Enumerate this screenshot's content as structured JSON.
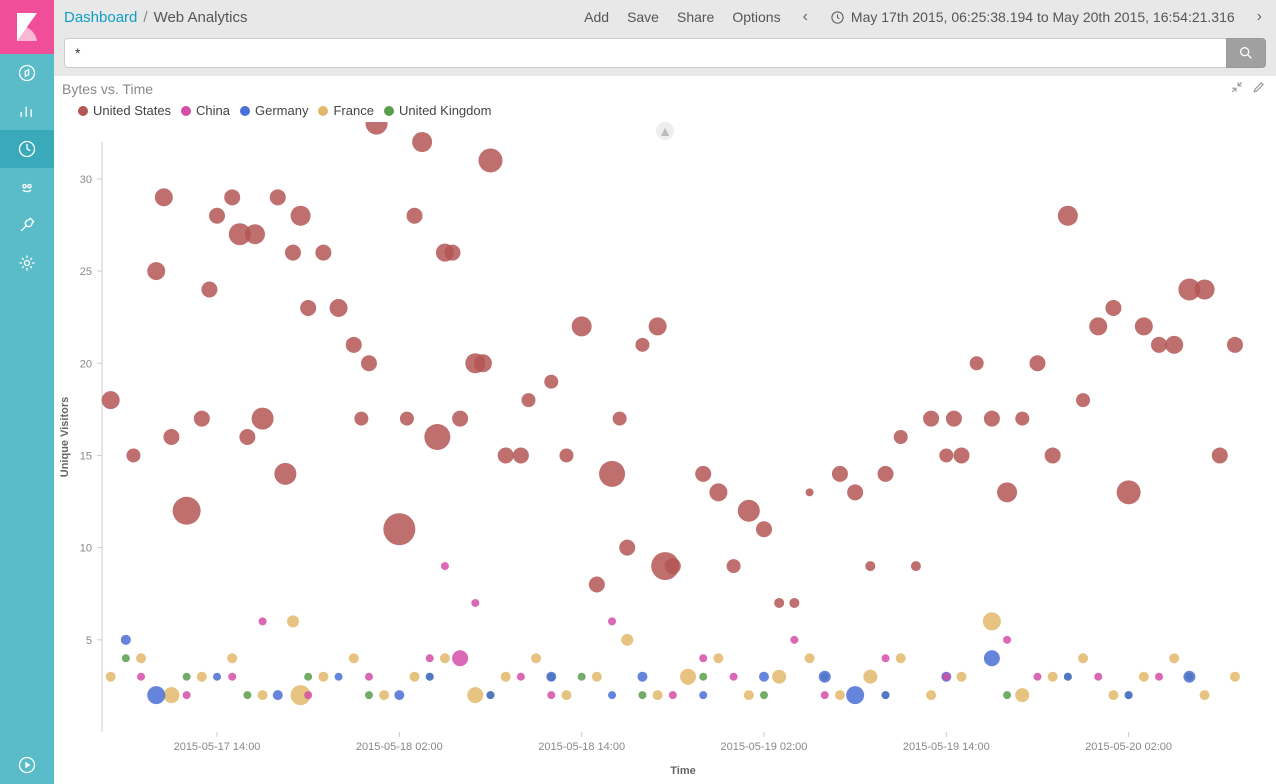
{
  "breadcrumb": {
    "root": "Dashboard",
    "current": "Web Analytics"
  },
  "actions": {
    "add": "Add",
    "save": "Save",
    "share": "Share",
    "options": "Options"
  },
  "time_range": "May 17th 2015, 06:25:38.194 to May 20th 2015, 16:54:21.316",
  "search": {
    "value": "*",
    "placeholder": ""
  },
  "panel": {
    "title": "Bytes vs. Time"
  },
  "legend": {
    "items": [
      {
        "key": "us",
        "label": "United States",
        "color": "#b35655"
      },
      {
        "key": "cn",
        "label": "China",
        "color": "#d54da8"
      },
      {
        "key": "de",
        "label": "Germany",
        "color": "#4a6fd6"
      },
      {
        "key": "fr",
        "label": "France",
        "color": "#e3b86b"
      },
      {
        "key": "gb",
        "label": "United Kingdom",
        "color": "#5a9e4d"
      }
    ]
  },
  "chart_data": {
    "type": "scatter",
    "title": "Bytes vs. Time",
    "xlabel": "Time",
    "ylabel": "Unique Visitors",
    "ylim": [
      0,
      32
    ],
    "x_ticks": [
      "2015-05-17 14:00",
      "2015-05-18 02:00",
      "2015-05-18 14:00",
      "2015-05-19 02:00",
      "2015-05-19 14:00",
      "2015-05-20 02:00"
    ],
    "x_tick_hours": [
      14,
      26,
      38,
      50,
      62,
      74
    ],
    "x_range_hours": [
      6.43,
      82.91
    ],
    "series": [
      {
        "name": "United States",
        "color": "#b35655",
        "points": [
          {
            "x": 7,
            "y": 18,
            "r": 9
          },
          {
            "x": 8.5,
            "y": 15,
            "r": 7
          },
          {
            "x": 10,
            "y": 25,
            "r": 9
          },
          {
            "x": 10.5,
            "y": 29,
            "r": 9
          },
          {
            "x": 11,
            "y": 16,
            "r": 8
          },
          {
            "x": 12,
            "y": 12,
            "r": 14
          },
          {
            "x": 13,
            "y": 17,
            "r": 8
          },
          {
            "x": 13.5,
            "y": 24,
            "r": 8
          },
          {
            "x": 14,
            "y": 28,
            "r": 8
          },
          {
            "x": 15,
            "y": 29,
            "r": 8
          },
          {
            "x": 15.5,
            "y": 27,
            "r": 11
          },
          {
            "x": 16,
            "y": 16,
            "r": 8
          },
          {
            "x": 16.5,
            "y": 27,
            "r": 10
          },
          {
            "x": 17,
            "y": 17,
            "r": 11
          },
          {
            "x": 18,
            "y": 29,
            "r": 8
          },
          {
            "x": 18.5,
            "y": 14,
            "r": 11
          },
          {
            "x": 19,
            "y": 26,
            "r": 8
          },
          {
            "x": 19.5,
            "y": 28,
            "r": 10
          },
          {
            "x": 20,
            "y": 23,
            "r": 8
          },
          {
            "x": 21,
            "y": 26,
            "r": 8
          },
          {
            "x": 22,
            "y": 23,
            "r": 9
          },
          {
            "x": 23,
            "y": 21,
            "r": 8
          },
          {
            "x": 23.5,
            "y": 17,
            "r": 7
          },
          {
            "x": 24,
            "y": 20,
            "r": 8
          },
          {
            "x": 24.5,
            "y": 33,
            "r": 11
          },
          {
            "x": 26,
            "y": 11,
            "r": 16
          },
          {
            "x": 26.5,
            "y": 17,
            "r": 7
          },
          {
            "x": 27,
            "y": 28,
            "r": 8
          },
          {
            "x": 27.5,
            "y": 32,
            "r": 10
          },
          {
            "x": 28.5,
            "y": 16,
            "r": 13
          },
          {
            "x": 29,
            "y": 26,
            "r": 9
          },
          {
            "x": 29.5,
            "y": 26,
            "r": 8
          },
          {
            "x": 30,
            "y": 17,
            "r": 8
          },
          {
            "x": 31,
            "y": 20,
            "r": 10
          },
          {
            "x": 31.5,
            "y": 20,
            "r": 9
          },
          {
            "x": 32,
            "y": 31,
            "r": 12
          },
          {
            "x": 33,
            "y": 15,
            "r": 8
          },
          {
            "x": 34,
            "y": 15,
            "r": 8
          },
          {
            "x": 34.5,
            "y": 18,
            "r": 7
          },
          {
            "x": 36,
            "y": 19,
            "r": 7
          },
          {
            "x": 37,
            "y": 15,
            "r": 7
          },
          {
            "x": 38,
            "y": 22,
            "r": 10
          },
          {
            "x": 39,
            "y": 8,
            "r": 8
          },
          {
            "x": 40,
            "y": 14,
            "r": 13
          },
          {
            "x": 40.5,
            "y": 17,
            "r": 7
          },
          {
            "x": 41,
            "y": 10,
            "r": 8
          },
          {
            "x": 42,
            "y": 21,
            "r": 7
          },
          {
            "x": 43,
            "y": 22,
            "r": 9
          },
          {
            "x": 43.5,
            "y": 9,
            "r": 14
          },
          {
            "x": 44,
            "y": 9,
            "r": 8
          },
          {
            "x": 46,
            "y": 14,
            "r": 8
          },
          {
            "x": 47,
            "y": 13,
            "r": 9
          },
          {
            "x": 48,
            "y": 9,
            "r": 7
          },
          {
            "x": 49,
            "y": 12,
            "r": 11
          },
          {
            "x": 50,
            "y": 11,
            "r": 8
          },
          {
            "x": 51,
            "y": 7,
            "r": 5
          },
          {
            "x": 52,
            "y": 7,
            "r": 5
          },
          {
            "x": 53,
            "y": 13,
            "r": 4
          },
          {
            "x": 55,
            "y": 14,
            "r": 8
          },
          {
            "x": 56,
            "y": 13,
            "r": 8
          },
          {
            "x": 57,
            "y": 9,
            "r": 5
          },
          {
            "x": 58,
            "y": 14,
            "r": 8
          },
          {
            "x": 59,
            "y": 16,
            "r": 7
          },
          {
            "x": 60,
            "y": 9,
            "r": 5
          },
          {
            "x": 61,
            "y": 17,
            "r": 8
          },
          {
            "x": 62,
            "y": 15,
            "r": 7
          },
          {
            "x": 62.5,
            "y": 17,
            "r": 8
          },
          {
            "x": 63,
            "y": 15,
            "r": 8
          },
          {
            "x": 64,
            "y": 20,
            "r": 7
          },
          {
            "x": 65,
            "y": 17,
            "r": 8
          },
          {
            "x": 66,
            "y": 13,
            "r": 10
          },
          {
            "x": 67,
            "y": 17,
            "r": 7
          },
          {
            "x": 68,
            "y": 20,
            "r": 8
          },
          {
            "x": 69,
            "y": 15,
            "r": 8
          },
          {
            "x": 70,
            "y": 28,
            "r": 10
          },
          {
            "x": 71,
            "y": 18,
            "r": 7
          },
          {
            "x": 72,
            "y": 22,
            "r": 9
          },
          {
            "x": 73,
            "y": 23,
            "r": 8
          },
          {
            "x": 74,
            "y": 13,
            "r": 12
          },
          {
            "x": 75,
            "y": 22,
            "r": 9
          },
          {
            "x": 76,
            "y": 21,
            "r": 8
          },
          {
            "x": 77,
            "y": 21,
            "r": 9
          },
          {
            "x": 78,
            "y": 24,
            "r": 11
          },
          {
            "x": 79,
            "y": 24,
            "r": 10
          },
          {
            "x": 80,
            "y": 15,
            "r": 8
          },
          {
            "x": 81,
            "y": 21,
            "r": 8
          }
        ]
      },
      {
        "name": "China",
        "color": "#d54da8",
        "points": [
          {
            "x": 9,
            "y": 3,
            "r": 4
          },
          {
            "x": 12,
            "y": 2,
            "r": 4
          },
          {
            "x": 15,
            "y": 3,
            "r": 4
          },
          {
            "x": 17,
            "y": 6,
            "r": 4
          },
          {
            "x": 20,
            "y": 2,
            "r": 4
          },
          {
            "x": 24,
            "y": 3,
            "r": 4
          },
          {
            "x": 28,
            "y": 4,
            "r": 4
          },
          {
            "x": 29,
            "y": 9,
            "r": 4
          },
          {
            "x": 30,
            "y": 4,
            "r": 8
          },
          {
            "x": 31,
            "y": 7,
            "r": 4
          },
          {
            "x": 34,
            "y": 3,
            "r": 4
          },
          {
            "x": 36,
            "y": 2,
            "r": 4
          },
          {
            "x": 40,
            "y": 6,
            "r": 4
          },
          {
            "x": 44,
            "y": 2,
            "r": 4
          },
          {
            "x": 46,
            "y": 4,
            "r": 4
          },
          {
            "x": 48,
            "y": 3,
            "r": 4
          },
          {
            "x": 52,
            "y": 5,
            "r": 4
          },
          {
            "x": 54,
            "y": 2,
            "r": 4
          },
          {
            "x": 58,
            "y": 4,
            "r": 4
          },
          {
            "x": 62,
            "y": 3,
            "r": 4
          },
          {
            "x": 66,
            "y": 5,
            "r": 4
          },
          {
            "x": 68,
            "y": 3,
            "r": 4
          },
          {
            "x": 72,
            "y": 3,
            "r": 4
          },
          {
            "x": 76,
            "y": 3,
            "r": 4
          }
        ]
      },
      {
        "name": "Germany",
        "color": "#4a6fd6",
        "points": [
          {
            "x": 8,
            "y": 5,
            "r": 5
          },
          {
            "x": 10,
            "y": 2,
            "r": 9
          },
          {
            "x": 14,
            "y": 3,
            "r": 4
          },
          {
            "x": 18,
            "y": 2,
            "r": 5
          },
          {
            "x": 22,
            "y": 3,
            "r": 4
          },
          {
            "x": 26,
            "y": 2,
            "r": 5
          },
          {
            "x": 28,
            "y": 3,
            "r": 4
          },
          {
            "x": 32,
            "y": 2,
            "r": 4
          },
          {
            "x": 36,
            "y": 3,
            "r": 5
          },
          {
            "x": 40,
            "y": 2,
            "r": 4
          },
          {
            "x": 42,
            "y": 3,
            "r": 5
          },
          {
            "x": 46,
            "y": 2,
            "r": 4
          },
          {
            "x": 50,
            "y": 3,
            "r": 5
          },
          {
            "x": 54,
            "y": 3,
            "r": 6
          },
          {
            "x": 56,
            "y": 2,
            "r": 9
          },
          {
            "x": 58,
            "y": 2,
            "r": 4
          },
          {
            "x": 62,
            "y": 3,
            "r": 5
          },
          {
            "x": 65,
            "y": 4,
            "r": 8
          },
          {
            "x": 70,
            "y": 3,
            "r": 4
          },
          {
            "x": 74,
            "y": 2,
            "r": 4
          },
          {
            "x": 78,
            "y": 3,
            "r": 6
          }
        ]
      },
      {
        "name": "France",
        "color": "#e3b86b",
        "points": [
          {
            "x": 7,
            "y": 3,
            "r": 5
          },
          {
            "x": 9,
            "y": 4,
            "r": 5
          },
          {
            "x": 11,
            "y": 2,
            "r": 8
          },
          {
            "x": 13,
            "y": 3,
            "r": 5
          },
          {
            "x": 15,
            "y": 4,
            "r": 5
          },
          {
            "x": 17,
            "y": 2,
            "r": 5
          },
          {
            "x": 19,
            "y": 6,
            "r": 6
          },
          {
            "x": 19.5,
            "y": 2,
            "r": 10
          },
          {
            "x": 21,
            "y": 3,
            "r": 5
          },
          {
            "x": 23,
            "y": 4,
            "r": 5
          },
          {
            "x": 25,
            "y": 2,
            "r": 5
          },
          {
            "x": 27,
            "y": 3,
            "r": 5
          },
          {
            "x": 29,
            "y": 4,
            "r": 5
          },
          {
            "x": 31,
            "y": 2,
            "r": 8
          },
          {
            "x": 33,
            "y": 3,
            "r": 5
          },
          {
            "x": 35,
            "y": 4,
            "r": 5
          },
          {
            "x": 37,
            "y": 2,
            "r": 5
          },
          {
            "x": 39,
            "y": 3,
            "r": 5
          },
          {
            "x": 41,
            "y": 5,
            "r": 6
          },
          {
            "x": 43,
            "y": 2,
            "r": 5
          },
          {
            "x": 45,
            "y": 3,
            "r": 8
          },
          {
            "x": 47,
            "y": 4,
            "r": 5
          },
          {
            "x": 49,
            "y": 2,
            "r": 5
          },
          {
            "x": 51,
            "y": 3,
            "r": 7
          },
          {
            "x": 53,
            "y": 4,
            "r": 5
          },
          {
            "x": 55,
            "y": 2,
            "r": 5
          },
          {
            "x": 57,
            "y": 3,
            "r": 7
          },
          {
            "x": 59,
            "y": 4,
            "r": 5
          },
          {
            "x": 61,
            "y": 2,
            "r": 5
          },
          {
            "x": 63,
            "y": 3,
            "r": 5
          },
          {
            "x": 65,
            "y": 6,
            "r": 9
          },
          {
            "x": 67,
            "y": 2,
            "r": 7
          },
          {
            "x": 69,
            "y": 3,
            "r": 5
          },
          {
            "x": 71,
            "y": 4,
            "r": 5
          },
          {
            "x": 73,
            "y": 2,
            "r": 5
          },
          {
            "x": 75,
            "y": 3,
            "r": 5
          },
          {
            "x": 77,
            "y": 4,
            "r": 5
          },
          {
            "x": 79,
            "y": 2,
            "r": 5
          },
          {
            "x": 81,
            "y": 3,
            "r": 5
          }
        ]
      },
      {
        "name": "United Kingdom",
        "color": "#5a9e4d",
        "points": [
          {
            "x": 8,
            "y": 4,
            "r": 4
          },
          {
            "x": 12,
            "y": 3,
            "r": 4
          },
          {
            "x": 16,
            "y": 2,
            "r": 4
          },
          {
            "x": 20,
            "y": 3,
            "r": 4
          },
          {
            "x": 24,
            "y": 2,
            "r": 4
          },
          {
            "x": 28,
            "y": 3,
            "r": 4
          },
          {
            "x": 32,
            "y": 2,
            "r": 4
          },
          {
            "x": 36,
            "y": 3,
            "r": 4
          },
          {
            "x": 38,
            "y": 3,
            "r": 4
          },
          {
            "x": 42,
            "y": 2,
            "r": 4
          },
          {
            "x": 46,
            "y": 3,
            "r": 4
          },
          {
            "x": 50,
            "y": 2,
            "r": 4
          },
          {
            "x": 54,
            "y": 3,
            "r": 4
          },
          {
            "x": 58,
            "y": 2,
            "r": 4
          },
          {
            "x": 62,
            "y": 3,
            "r": 4
          },
          {
            "x": 66,
            "y": 2,
            "r": 4
          },
          {
            "x": 70,
            "y": 3,
            "r": 4
          },
          {
            "x": 74,
            "y": 2,
            "r": 4
          },
          {
            "x": 78,
            "y": 3,
            "r": 4
          }
        ]
      }
    ]
  }
}
